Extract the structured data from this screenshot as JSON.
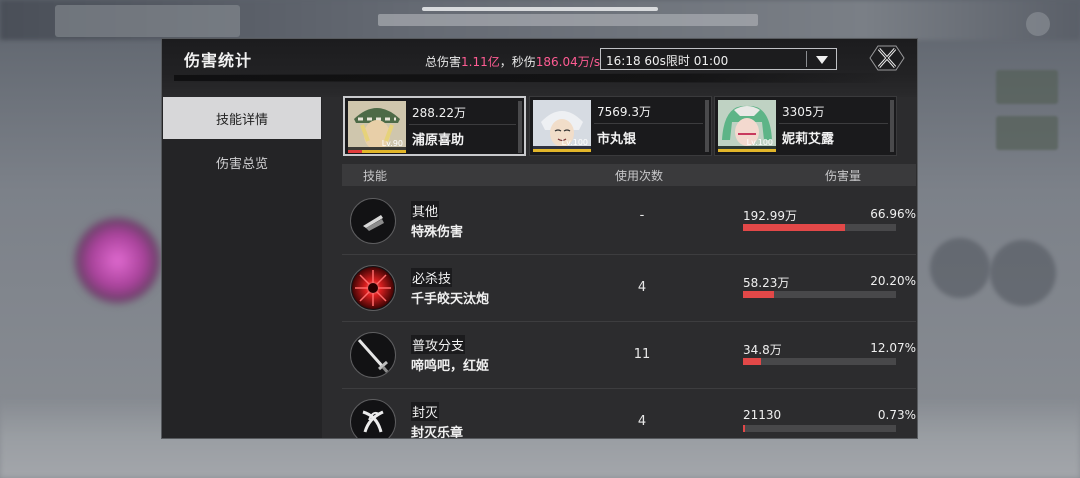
{
  "dialog": {
    "title": "伤害统计",
    "stats": {
      "total_label": "总伤害",
      "total_value": "1.11亿",
      "sep": "，",
      "dps_label": "秒伤",
      "dps_value": "186.04万/s"
    },
    "filter": {
      "value": "16:18 60s限时 01:00"
    },
    "close_label": "关闭"
  },
  "sidebar": {
    "items": [
      {
        "label": "技能详情",
        "active": true
      },
      {
        "label": "伤害总览",
        "active": false
      }
    ]
  },
  "characters": [
    {
      "damage": "288.22万",
      "name": "浦原喜助",
      "level": "Lv.90",
      "selected": true
    },
    {
      "damage": "7569.3万",
      "name": "市丸银",
      "level": "Lv.100",
      "selected": false
    },
    {
      "damage": "3305万",
      "name": "妮莉艾露",
      "level": "Lv.100",
      "selected": false
    }
  ],
  "table": {
    "headers": {
      "skill": "技能",
      "uses": "使用次数",
      "damage": "伤害量"
    },
    "rows": [
      {
        "category": "其他",
        "name": "特殊伤害",
        "uses": "-",
        "damage": "192.99万",
        "percent": "66.96%",
        "share": 0.6696
      },
      {
        "category": "必杀技",
        "name": "千手皎天汰炮",
        "uses": "4",
        "damage": "58.23万",
        "percent": "20.20%",
        "share": 0.202
      },
      {
        "category": "普攻分支",
        "name": "啼鸣吧，红姬",
        "uses": "11",
        "damage": "34.8万",
        "percent": "12.07%",
        "share": 0.1207
      },
      {
        "category": "封灭",
        "name": "封灭乐章",
        "uses": "4",
        "damage": "21130",
        "percent": "0.73%",
        "share": 0.0073
      }
    ]
  },
  "colors": {
    "accent_pink": "#ff5c93",
    "bar_red": "#e24848",
    "level_gold": "#e2b62a"
  }
}
